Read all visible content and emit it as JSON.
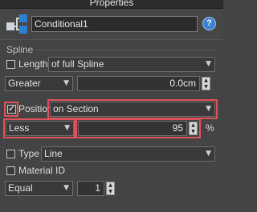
{
  "window": {
    "title": "Properties"
  },
  "object": {
    "name": "Conditional1",
    "icon": "conditional-object-icon",
    "help_label": "?"
  },
  "spline_group": {
    "label": "Spline"
  },
  "length_row": {
    "label": "Length",
    "checked": false,
    "dropdown_value": "of full Spline"
  },
  "length_compare": {
    "operator": "Greater",
    "value": "0.0cm"
  },
  "position_row": {
    "label": "Position",
    "checked": true,
    "dropdown_value": "on Section"
  },
  "position_compare": {
    "operator": "Less",
    "value": "95",
    "unit": "%"
  },
  "type_row": {
    "label": "Type",
    "checked": false,
    "dropdown_value": "Line"
  },
  "material_row": {
    "label": "Material ID",
    "checked": false
  },
  "material_compare": {
    "operator": "Equal",
    "value": "1"
  },
  "highlight_color": "#e0505a"
}
